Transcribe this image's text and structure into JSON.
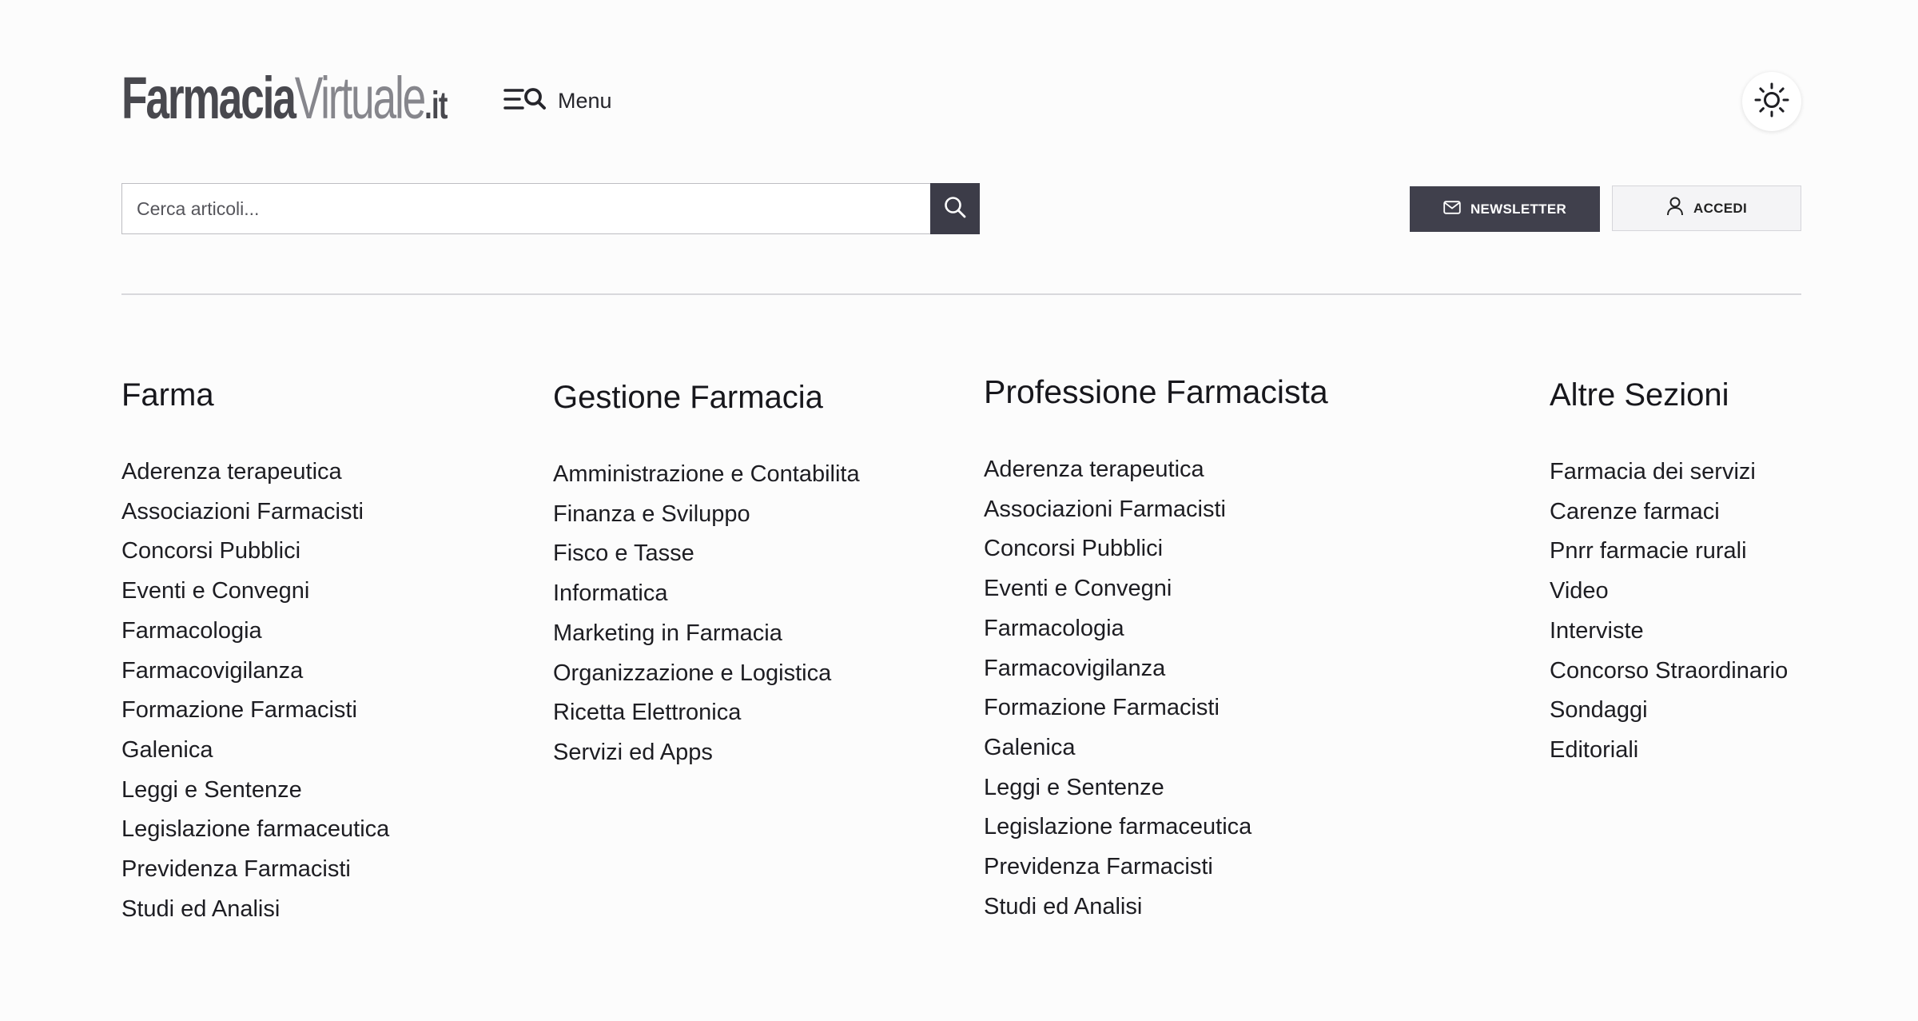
{
  "header": {
    "logo": {
      "part1": "Farmacia",
      "part2": "Virtuale",
      "part3": ".it"
    },
    "menu_label": "Menu",
    "theme_icon": "sun-icon"
  },
  "search": {
    "placeholder": "Cerca articoli...",
    "value": "",
    "icon": "search-icon"
  },
  "buttons": {
    "newsletter": "NEWSLETTER",
    "accedi": "ACCEDI"
  },
  "colors": {
    "dark_button": "#40404c",
    "search_button": "#3c3c48",
    "background": "#fcfcfc"
  },
  "columns": [
    {
      "title": "Farma",
      "items": [
        "Aderenza terapeutica",
        "Associazioni Farmacisti",
        "Concorsi Pubblici",
        "Eventi e Convegni",
        "Farmacologia",
        "Farmacovigilanza",
        "Formazione Farmacisti",
        "Galenica",
        "Leggi e Sentenze",
        "Legislazione farmaceutica",
        "Previdenza Farmacisti",
        "Studi ed Analisi"
      ]
    },
    {
      "title": "Gestione Farmacia",
      "items": [
        "Amministrazione e Contabilita",
        "Finanza e Sviluppo",
        "Fisco e Tasse",
        "Informatica",
        "Marketing in Farmacia",
        "Organizzazione e Logistica",
        "Ricetta Elettronica",
        "Servizi ed Apps"
      ]
    },
    {
      "title": "Professione Farmacista",
      "items": [
        "Aderenza terapeutica",
        "Associazioni Farmacisti",
        "Concorsi Pubblici",
        "Eventi e Convegni",
        "Farmacologia",
        "Farmacovigilanza",
        "Formazione Farmacisti",
        "Galenica",
        "Leggi e Sentenze",
        "Legislazione farmaceutica",
        "Previdenza Farmacisti",
        "Studi ed Analisi"
      ]
    },
    {
      "title": "Altre Sezioni",
      "items": [
        "Farmacia dei servizi",
        "Carenze farmaci",
        "Pnrr farmacie rurali",
        "Video",
        "Interviste",
        "Concorso Straordinario",
        "Sondaggi",
        "Editoriali"
      ]
    }
  ]
}
